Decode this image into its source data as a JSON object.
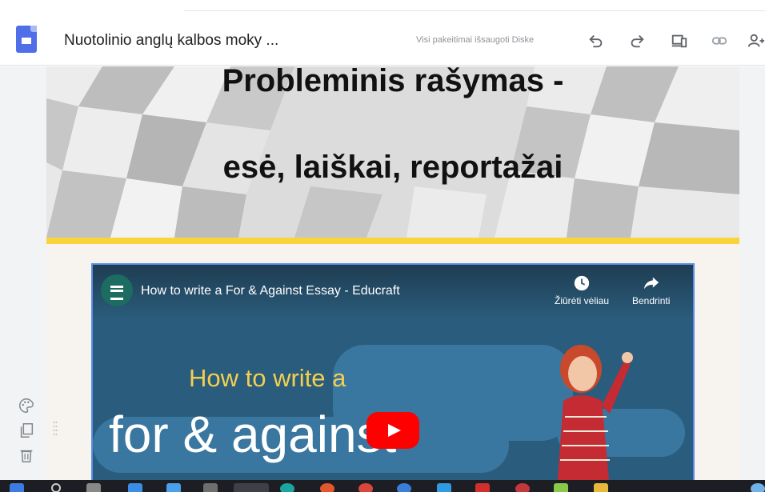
{
  "header": {
    "doc_title": "Nuotolinio anglų kalbos moky  ...",
    "save_status": "Visi pakeitimai išsaugoti Diske"
  },
  "banner": {
    "title_line1": "Probleminis rašymas -",
    "title_line2": "esė, laiškai, reportažai"
  },
  "video": {
    "title": "How to write a For & Against Essay - Educraft",
    "watch_later": "Žiūrėti vėliau",
    "share": "Bendrinti",
    "thumb_line1": "How to write a",
    "thumb_line2": "for & against"
  },
  "colors": {
    "accent_blue": "#4f6ee8",
    "banner_bar": "#f9d43a",
    "video_bg": "#2a5d7d",
    "play_red": "#ff0000"
  }
}
